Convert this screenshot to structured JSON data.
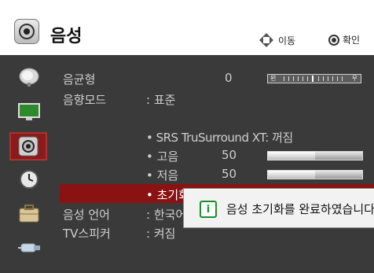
{
  "header": {
    "title": "음성",
    "move_label": "이동",
    "ok_label": "확인"
  },
  "sidebar": {
    "items": [
      {
        "icon": "satellite-dish-icon"
      },
      {
        "icon": "monitor-icon"
      },
      {
        "icon": "speaker-icon",
        "active": true
      },
      {
        "icon": "clock-icon"
      },
      {
        "icon": "toolbox-icon"
      },
      {
        "icon": "input-device-icon"
      }
    ]
  },
  "menu": {
    "balance": {
      "label": "음균형",
      "value": "0",
      "left_mark": "왼",
      "right_mark": "우"
    },
    "sound_mode": {
      "label": "음향모드",
      "value": ": 표준"
    },
    "srs": {
      "label": "• SRS TruSurround XT: 꺼짐"
    },
    "treble": {
      "label": "• 고음",
      "value": "50",
      "level": 0.5
    },
    "bass": {
      "label": "• 저음",
      "value": "50",
      "level": 0.5
    },
    "reset": {
      "label": "• 초기화"
    },
    "audio_language": {
      "label": "음성 언어",
      "value": ": 한국어"
    },
    "tv_speaker": {
      "label": "TV스피커",
      "value": ": 켜짐"
    }
  },
  "dialog": {
    "message": "음성 초기화를 완료하였습니다."
  }
}
